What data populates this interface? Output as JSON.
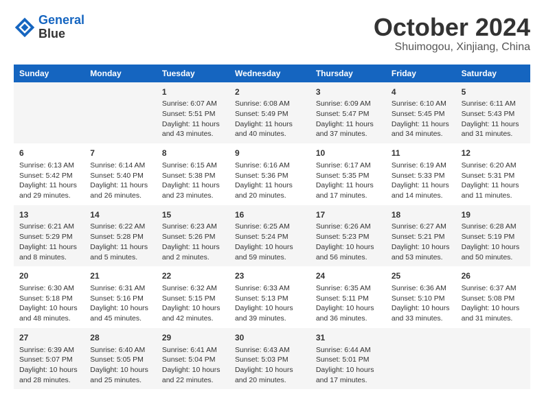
{
  "header": {
    "logo_line1": "General",
    "logo_line2": "Blue",
    "month_title": "October 2024",
    "location": "Shuimogou, Xinjiang, China"
  },
  "days_of_week": [
    "Sunday",
    "Monday",
    "Tuesday",
    "Wednesday",
    "Thursday",
    "Friday",
    "Saturday"
  ],
  "weeks": [
    [
      {
        "day": "",
        "info": ""
      },
      {
        "day": "",
        "info": ""
      },
      {
        "day": "1",
        "info": "Sunrise: 6:07 AM\nSunset: 5:51 PM\nDaylight: 11 hours and 43 minutes."
      },
      {
        "day": "2",
        "info": "Sunrise: 6:08 AM\nSunset: 5:49 PM\nDaylight: 11 hours and 40 minutes."
      },
      {
        "day": "3",
        "info": "Sunrise: 6:09 AM\nSunset: 5:47 PM\nDaylight: 11 hours and 37 minutes."
      },
      {
        "day": "4",
        "info": "Sunrise: 6:10 AM\nSunset: 5:45 PM\nDaylight: 11 hours and 34 minutes."
      },
      {
        "day": "5",
        "info": "Sunrise: 6:11 AM\nSunset: 5:43 PM\nDaylight: 11 hours and 31 minutes."
      }
    ],
    [
      {
        "day": "6",
        "info": "Sunrise: 6:13 AM\nSunset: 5:42 PM\nDaylight: 11 hours and 29 minutes."
      },
      {
        "day": "7",
        "info": "Sunrise: 6:14 AM\nSunset: 5:40 PM\nDaylight: 11 hours and 26 minutes."
      },
      {
        "day": "8",
        "info": "Sunrise: 6:15 AM\nSunset: 5:38 PM\nDaylight: 11 hours and 23 minutes."
      },
      {
        "day": "9",
        "info": "Sunrise: 6:16 AM\nSunset: 5:36 PM\nDaylight: 11 hours and 20 minutes."
      },
      {
        "day": "10",
        "info": "Sunrise: 6:17 AM\nSunset: 5:35 PM\nDaylight: 11 hours and 17 minutes."
      },
      {
        "day": "11",
        "info": "Sunrise: 6:19 AM\nSunset: 5:33 PM\nDaylight: 11 hours and 14 minutes."
      },
      {
        "day": "12",
        "info": "Sunrise: 6:20 AM\nSunset: 5:31 PM\nDaylight: 11 hours and 11 minutes."
      }
    ],
    [
      {
        "day": "13",
        "info": "Sunrise: 6:21 AM\nSunset: 5:29 PM\nDaylight: 11 hours and 8 minutes."
      },
      {
        "day": "14",
        "info": "Sunrise: 6:22 AM\nSunset: 5:28 PM\nDaylight: 11 hours and 5 minutes."
      },
      {
        "day": "15",
        "info": "Sunrise: 6:23 AM\nSunset: 5:26 PM\nDaylight: 11 hours and 2 minutes."
      },
      {
        "day": "16",
        "info": "Sunrise: 6:25 AM\nSunset: 5:24 PM\nDaylight: 10 hours and 59 minutes."
      },
      {
        "day": "17",
        "info": "Sunrise: 6:26 AM\nSunset: 5:23 PM\nDaylight: 10 hours and 56 minutes."
      },
      {
        "day": "18",
        "info": "Sunrise: 6:27 AM\nSunset: 5:21 PM\nDaylight: 10 hours and 53 minutes."
      },
      {
        "day": "19",
        "info": "Sunrise: 6:28 AM\nSunset: 5:19 PM\nDaylight: 10 hours and 50 minutes."
      }
    ],
    [
      {
        "day": "20",
        "info": "Sunrise: 6:30 AM\nSunset: 5:18 PM\nDaylight: 10 hours and 48 minutes."
      },
      {
        "day": "21",
        "info": "Sunrise: 6:31 AM\nSunset: 5:16 PM\nDaylight: 10 hours and 45 minutes."
      },
      {
        "day": "22",
        "info": "Sunrise: 6:32 AM\nSunset: 5:15 PM\nDaylight: 10 hours and 42 minutes."
      },
      {
        "day": "23",
        "info": "Sunrise: 6:33 AM\nSunset: 5:13 PM\nDaylight: 10 hours and 39 minutes."
      },
      {
        "day": "24",
        "info": "Sunrise: 6:35 AM\nSunset: 5:11 PM\nDaylight: 10 hours and 36 minutes."
      },
      {
        "day": "25",
        "info": "Sunrise: 6:36 AM\nSunset: 5:10 PM\nDaylight: 10 hours and 33 minutes."
      },
      {
        "day": "26",
        "info": "Sunrise: 6:37 AM\nSunset: 5:08 PM\nDaylight: 10 hours and 31 minutes."
      }
    ],
    [
      {
        "day": "27",
        "info": "Sunrise: 6:39 AM\nSunset: 5:07 PM\nDaylight: 10 hours and 28 minutes."
      },
      {
        "day": "28",
        "info": "Sunrise: 6:40 AM\nSunset: 5:05 PM\nDaylight: 10 hours and 25 minutes."
      },
      {
        "day": "29",
        "info": "Sunrise: 6:41 AM\nSunset: 5:04 PM\nDaylight: 10 hours and 22 minutes."
      },
      {
        "day": "30",
        "info": "Sunrise: 6:43 AM\nSunset: 5:03 PM\nDaylight: 10 hours and 20 minutes."
      },
      {
        "day": "31",
        "info": "Sunrise: 6:44 AM\nSunset: 5:01 PM\nDaylight: 10 hours and 17 minutes."
      },
      {
        "day": "",
        "info": ""
      },
      {
        "day": "",
        "info": ""
      }
    ]
  ]
}
